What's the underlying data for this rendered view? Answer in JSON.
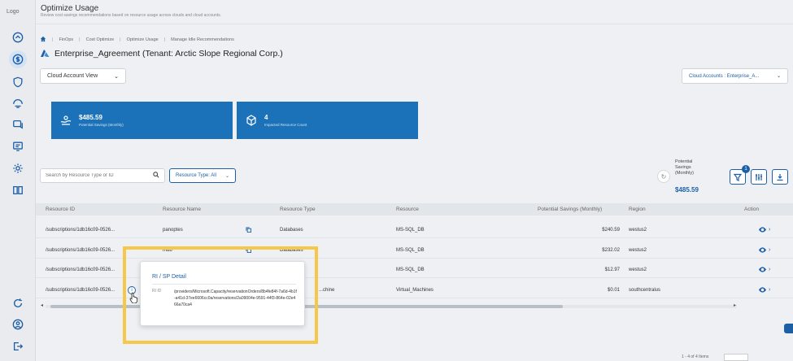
{
  "logo_alt": "Logo",
  "header": {
    "title": "Optimize Usage",
    "subtitle": "Review cost savings recommendations based on resource usage across clouds and cloud accounts."
  },
  "breadcrumb": [
    "FinOps",
    "Cost Optimize",
    "Optimize Usage",
    "Manage Idle Recommendations"
  ],
  "tenant": "Enterprise_Agreement (Tenant: Arctic Slope Regional Corp.)",
  "view_dropdown": "Cloud Account View",
  "accounts_dropdown": "Cloud Accounts : Enterprise_A...",
  "cards": [
    {
      "value": "$485.59",
      "label": "Potential Savings (Monthly)"
    },
    {
      "value": "4",
      "label": "Impacted Resource Count"
    }
  ],
  "search_placeholder": "Search by Resource Type or ID",
  "filter_label": "Resource Type: All",
  "potential_savings_label": "Potential Savings (Monthly)",
  "potential_savings_value": "$485.59",
  "filter_badge": "1",
  "table": {
    "headers": [
      "Resource ID",
      "Resource Name",
      "Resource Type",
      "Resource",
      "Potential Savings (Monthly)",
      "Region",
      "Action"
    ],
    "rows": [
      {
        "id": "/subscriptions/1db16c09-0526...",
        "name": "panoptes",
        "type": "Databases",
        "resource": "MS-SQL_DB",
        "savings": "$240.59",
        "region": "westus2"
      },
      {
        "id": "/subscriptions/1db16c09-0526...",
        "name": "mdb",
        "type": "Databases",
        "resource": "MS-SQL_DB",
        "savings": "$232.02",
        "region": "westus2"
      },
      {
        "id": "/subscriptions/1db16c09-0526...",
        "name": "",
        "type": "",
        "resource": "MS-SQL_DB",
        "savings": "$12.97",
        "region": "westus2"
      },
      {
        "id": "/subscriptions/1db16c09-0526...",
        "name": "",
        "type": "...chine",
        "resource": "Virtual_Machines",
        "savings": "$0.01",
        "region": "southcentralus"
      }
    ]
  },
  "popup": {
    "title": "RI / SP Detail",
    "label": "RI ID",
    "value": "/providers/Microsoft.Capacity/reservationOrders/8b4fe84f-7a6d-4b1f-a41d-37ee6606cc0a/reservations/2a09004e-9591-44f3-864e-02e466a70ca4"
  },
  "pager_text": "1 - 4 of 4 Items"
}
